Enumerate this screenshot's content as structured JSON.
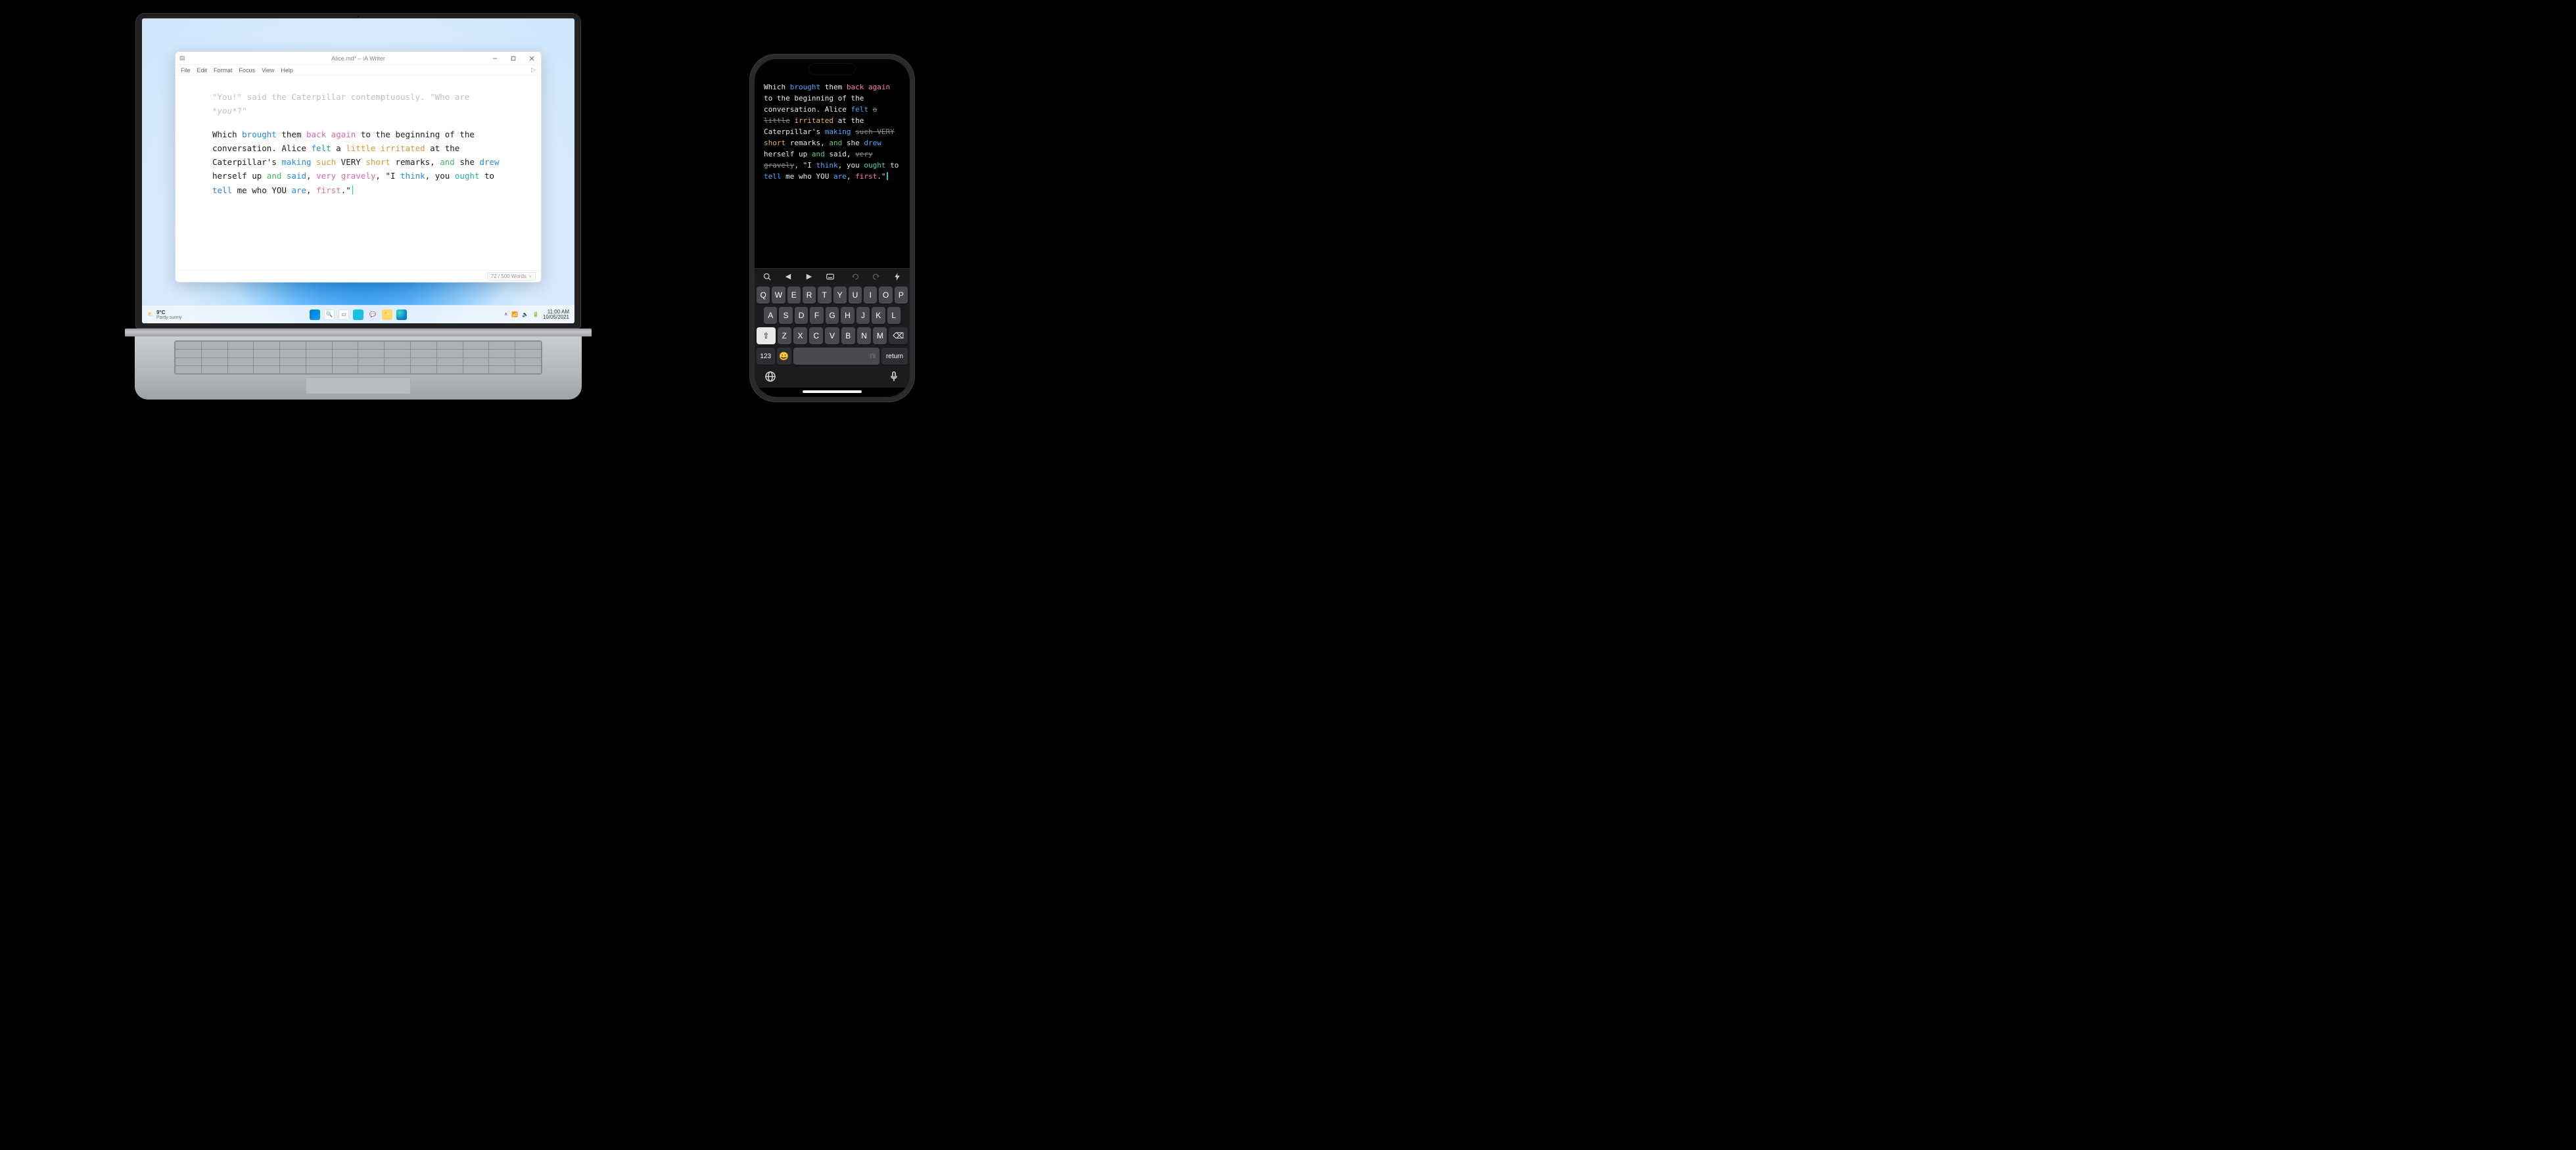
{
  "laptop": {
    "window": {
      "title": "Alice.md* – iA Writer",
      "menu": {
        "file": "File",
        "edit": "Edit",
        "format": "Format",
        "focus": "Focus",
        "view": "View",
        "help": "Help"
      },
      "status": {
        "words": "72 / 500 Words",
        "chev": "˅"
      }
    },
    "editor": {
      "dim_line1": "\"You!\" said the Caterpillar contemptuously. \"Who are ",
      "dim_ital": "*you*",
      "dim_line1b": "?\"",
      "p2": {
        "t0": "Which ",
        "brought": "brought",
        "t1": " them ",
        "back": "back",
        "again": "again",
        "t2": " to the beginning of the conversation. Alice ",
        "felt": "felt",
        "t3": " a ",
        "little": "little",
        "irritated": "irritated",
        "t4": " at the Caterpillar's ",
        "making": "making",
        "t4a": " ",
        "such": "such",
        "t5": " VERY ",
        "short": "short",
        "t6": " remarks, ",
        "and1": "and",
        "t7": " she ",
        "drew": "drew",
        "t8": " herself up ",
        "and2": "and",
        "t9": " ",
        "said": "said",
        "t10": ", ",
        "very": "very",
        "t10a": " ",
        "gravely": "gravely",
        "t11": ", \"I ",
        "think": "think",
        "t12": ", you ",
        "ought": "ought",
        "t13": " to ",
        "tell": "tell",
        "t14": " me who YOU ",
        "are": "are",
        "t15": ", ",
        "first": "first",
        "t16": ".\""
      }
    },
    "taskbar": {
      "temp": "9°C",
      "weather": "Partly sunny",
      "clock_time": "11:00 AM",
      "clock_date": "10/05/2021"
    }
  },
  "phone": {
    "editor": {
      "t0": "Which ",
      "brought": "brought",
      "t1": " them ",
      "back": "back",
      "t1a": " ",
      "again": "again",
      "t2": " to the beginning of the conversation. Alice ",
      "felt": "felt",
      "t3": " ",
      "a_strike": "a little",
      "t4": " ",
      "irritated": "irritated",
      "t5": " at the Caterpillar's ",
      "making": "making",
      "t6": " ",
      "such_very_strike": "such VERY",
      "t7": " ",
      "short": "short",
      "t8": " remarks, ",
      "and1": "and",
      "t9": " she ",
      "drew": "drew",
      "t10": " herself up ",
      "and2": "and",
      "t11": " said, ",
      "very_gravely_strike": "very gravely",
      "t12": ", \"I ",
      "think": "think",
      "t13": ", you ",
      "ought": "ought",
      "t14": " to ",
      "tell": "tell",
      "t15": " me who YOU ",
      "are": "are",
      "t16": ", ",
      "first": "first",
      "t17": ".\""
    },
    "keyboard": {
      "row1": [
        "Q",
        "W",
        "E",
        "R",
        "T",
        "Y",
        "U",
        "I",
        "O",
        "P"
      ],
      "row2": [
        "A",
        "S",
        "D",
        "F",
        "G",
        "H",
        "J",
        "K",
        "L"
      ],
      "row3": [
        "Z",
        "X",
        "C",
        "V",
        "B",
        "N",
        "M"
      ],
      "shift": "⇧",
      "backspace": "⌫",
      "numkey": "123",
      "emoji": "😀",
      "space": "I'll",
      "return": "return"
    }
  }
}
